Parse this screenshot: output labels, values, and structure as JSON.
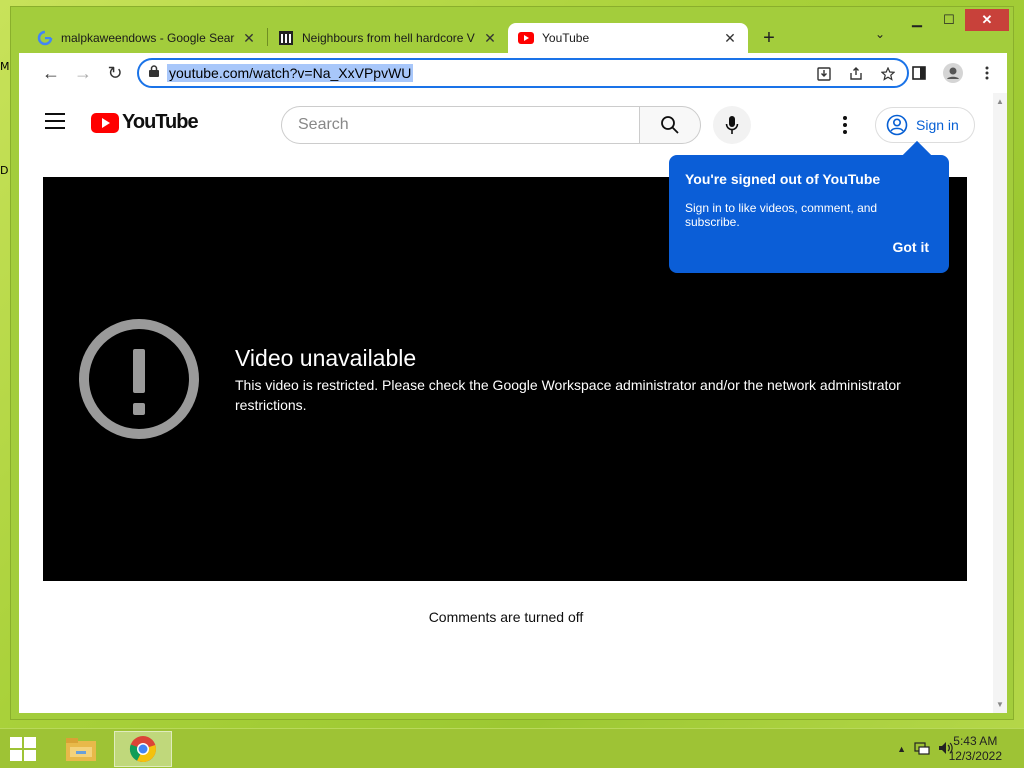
{
  "desktop": {
    "icon_labels": [
      "M",
      "D"
    ]
  },
  "window": {
    "controls": {
      "minimize": "▁",
      "maximize": "☐",
      "close": "✕"
    }
  },
  "tabs": [
    {
      "title": "malpkaweendows - Google Sear",
      "icon": "google-icon",
      "close": "✕"
    },
    {
      "title": "Neighbours from hell hardcore V",
      "icon": "institution-icon",
      "close": "✕"
    },
    {
      "title": "YouTube",
      "icon": "youtube-icon",
      "close": "✕",
      "active": true
    }
  ],
  "new_tab": "+",
  "tab_search": "⌄",
  "toolbar": {
    "back": "←",
    "forward": "→",
    "reload": "↻",
    "url": "youtube.com/watch?v=Na_XxVPpvWU",
    "lock": "🔒"
  },
  "youtube": {
    "logo_text": "YouTube",
    "search_placeholder": "Search",
    "sign_in": "Sign in",
    "popup": {
      "title": "You're signed out of YouTube",
      "text": "Sign in to like videos, comment, and subscribe.",
      "button": "Got it"
    },
    "error": {
      "title": "Video unavailable",
      "message": "This video is restricted. Please check the Google Workspace administrator and/or the network administrator restrictions."
    },
    "comments": "Comments are turned off"
  },
  "taskbar": {
    "time": "5:43 AM",
    "date": "12/3/2022",
    "tray_arrow": "▲"
  },
  "colors": {
    "accent": "#1a73e8",
    "youtube_red": "#ff0000",
    "popup_blue": "#0b5ed7",
    "desktop_green": "#a9d13a"
  }
}
